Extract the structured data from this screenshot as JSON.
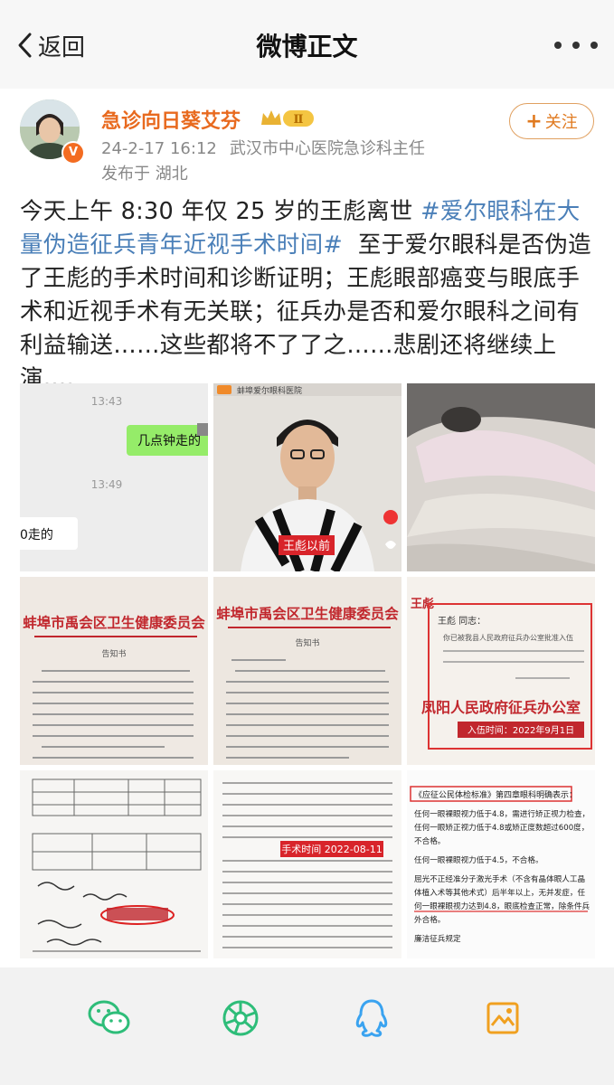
{
  "nav": {
    "back_label": "返回",
    "title": "微博正文",
    "more_icon": "more-icon"
  },
  "post": {
    "author": "急诊向日葵艾芬",
    "level": "Ⅱ",
    "verified_mark": "V",
    "timestamp": "24-2-17 16:12",
    "source": "武汉市中心医院急诊科主任",
    "location": "发布于 湖北",
    "follow_label": "关注",
    "text_part1": "今天上午 8:30 年仅 25 岁的王彪离世",
    "hashtag": "#爱尔眼科在大量伪造征兵青年近视手术时间#",
    "text_part2": "至于爱尔眼科是否伪造了王彪的手术时间和诊断证明；王彪眼部癌变与眼底手术和近视手术有无关联；征兵办是否和爱尔眼科之间有利益输送……这些都将不了了之……悲剧还将继续上演….",
    "colors": {
      "author": "#e86a1f",
      "hashtag": "#4a7fb8",
      "follow": "#e07a20"
    }
  },
  "images": {
    "chat": {
      "time1": "13:43",
      "bubble": "几点钟走的",
      "time2": "13:49",
      "reply": "0走的"
    },
    "video": {
      "banner": "蚌埠爱尔眼科医院",
      "caption": "王彪以前"
    },
    "notice1": {
      "header": "蚌埠市禹会区卫生健康委员会",
      "subtitle": "告知书"
    },
    "notice2": {
      "header": "蚌埠市禹会区卫生健康委员会",
      "subtitle": "告知书"
    },
    "enlist": {
      "corner": "王彪",
      "salutation": "王彪 同志：",
      "body": "你已被我县人民政府征兵办公室批准入伍",
      "office": "凤阳人民政府征兵办公室",
      "date": "入伍时间：2022年9月1日"
    },
    "record2": {
      "surgery_time": "手术时间 2022-08-11"
    },
    "standard": {
      "title": "《应征公民体检标准》第四章眼科明确表示：",
      "line1": "任何一眼裸眼视力低于4.8，需进行矫正视力检查，任何一眼矫正视力低于4.8或矫正度数超过600度，不合格。",
      "line2": "任何一眼裸眼视力低于4.5，不合格。",
      "line3": "屈光不正经准分子激光手术（不含有晶体眼人工晶体植入术等其他术式）后半年以上，无并发症，任何一眼裸眼视力达到4.8，眼底检查正常，除条件兵外合格。",
      "footer": "廉洁征兵规定"
    }
  },
  "share": {
    "icons": [
      "wechat-icon",
      "moments-icon",
      "qq-icon",
      "save-image-icon"
    ]
  }
}
